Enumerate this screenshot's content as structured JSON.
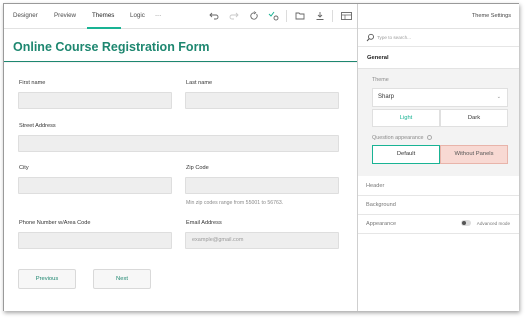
{
  "tabs": [
    {
      "label": "Designer"
    },
    {
      "label": "Preview"
    },
    {
      "label": "Themes"
    },
    {
      "label": "Logic"
    },
    {
      "label": "···"
    }
  ],
  "active_tab": "Themes",
  "toolbar_icons": [
    "undo-icon",
    "redo-icon",
    "reset-icon",
    "settings-check-icon",
    "open-icon",
    "download-icon",
    "panel-toggle-icon"
  ],
  "form": {
    "title": "Online Course Registration Form",
    "fields": {
      "first_name": {
        "label": "First name",
        "value": ""
      },
      "last_name": {
        "label": "Last name",
        "value": ""
      },
      "street": {
        "label": "Street Address",
        "value": ""
      },
      "city": {
        "label": "City",
        "value": ""
      },
      "zip": {
        "label": "Zip Code",
        "value": "",
        "hint": "Min zip codes range from 55001 to 56763."
      },
      "phone": {
        "label": "Phone Number w/Area Code",
        "value": ""
      },
      "email": {
        "label": "Email Address",
        "placeholder": "example@gmail.com"
      }
    },
    "buttons": {
      "previous": "Previous",
      "next": "Next"
    }
  },
  "panel": {
    "title": "Theme Settings",
    "search_placeholder": "Type to search...",
    "general": "General",
    "theme_label": "Theme",
    "theme_value": "Sharp",
    "mode_light": "Light",
    "mode_dark": "Dark",
    "question_appearance_label": "Question appearance",
    "appearance_default": "Default",
    "appearance_without_panels": "Without Panels",
    "sections": {
      "header": "Header",
      "background": "Background",
      "appearance": "Appearance"
    },
    "advanced_mode": "Advanced mode"
  },
  "colors": {
    "accent": "#19b394",
    "title": "#1e8770",
    "selected_bg": "#f8d9d3"
  }
}
